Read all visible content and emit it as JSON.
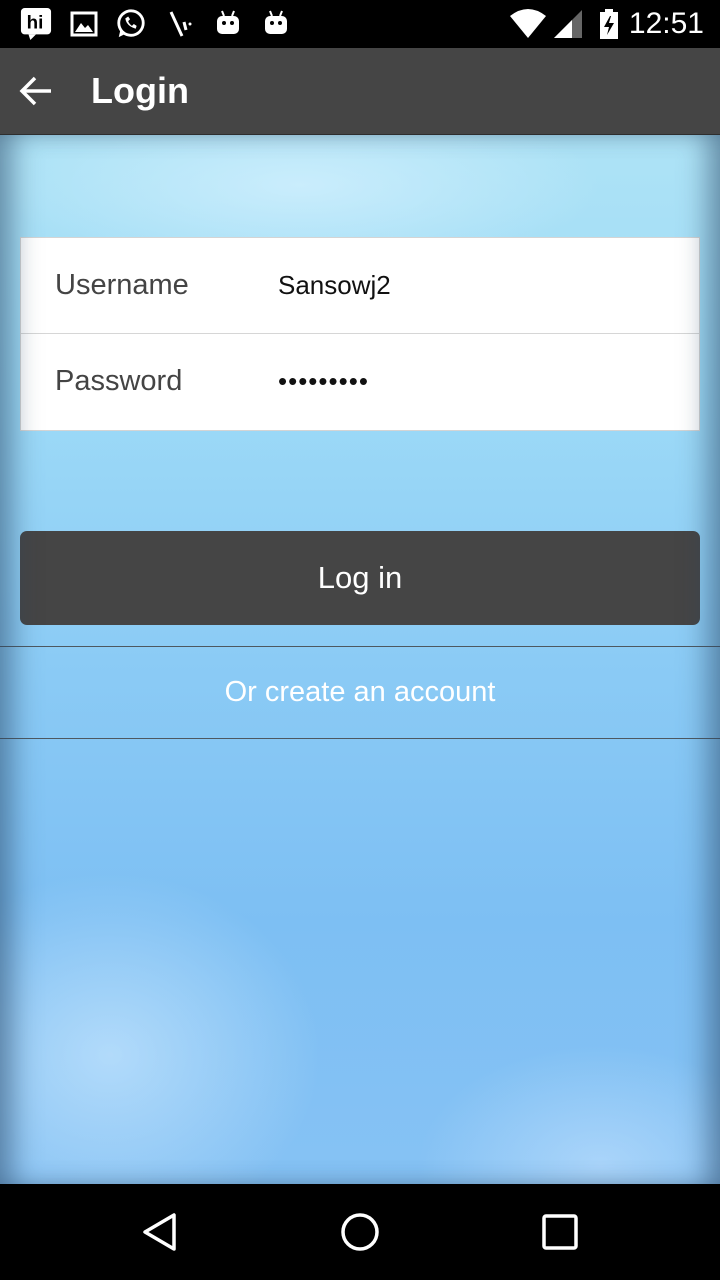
{
  "status_bar": {
    "time": "12:51",
    "notification_icons": [
      "hi-app-icon",
      "gallery-icon",
      "whatsapp-icon",
      "tools-icon",
      "android-icon",
      "android-icon"
    ],
    "system_icons": [
      "wifi-icon",
      "cell-signal-icon",
      "battery-charging-icon"
    ]
  },
  "toolbar": {
    "back_icon": "arrow-left-icon",
    "title": "Login"
  },
  "form": {
    "username_label": "Username",
    "username_value": "Sansowj2",
    "password_label": "Password",
    "password_value": "•••••••••"
  },
  "login_button_label": "Log in",
  "create_account_label": "Or create an account",
  "nav_bar": {
    "buttons": [
      "back-triangle-icon",
      "home-circle-icon",
      "recents-square-icon"
    ]
  },
  "colors": {
    "toolbar": "#454545",
    "button": "#454545",
    "background_light": "#aee3f6",
    "background_dark": "#7dbff3",
    "link_text": "#ffffff"
  }
}
